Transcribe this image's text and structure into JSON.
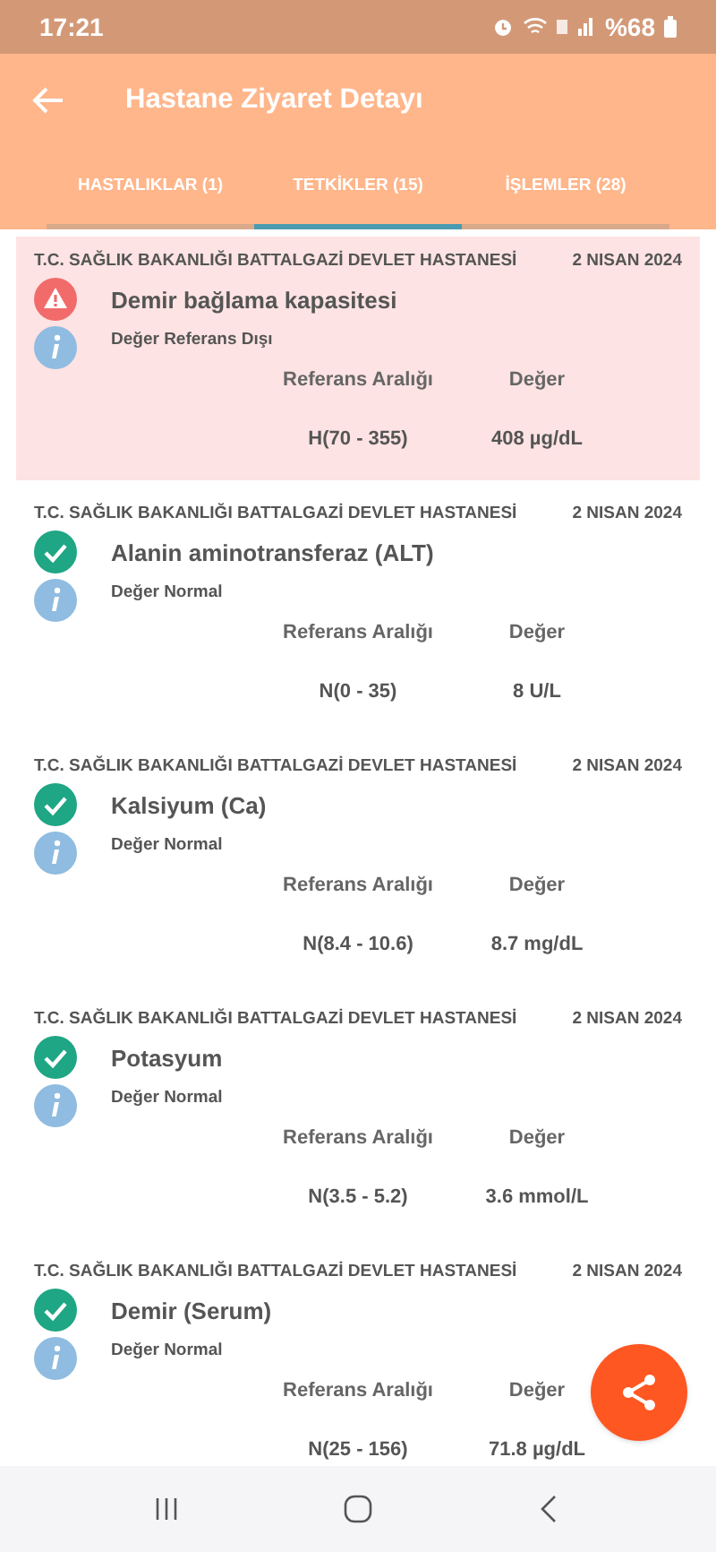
{
  "status_bar": {
    "time": "17:21",
    "battery": "%68"
  },
  "header": {
    "title": "Hastane Ziyaret Detayı"
  },
  "tabs": [
    {
      "label": "HASTALIKLAR (1)",
      "selected": false
    },
    {
      "label": "TETKİKLER (15)",
      "selected": true
    },
    {
      "label": "İŞLEMLER (28)",
      "selected": false
    }
  ],
  "tests": [
    {
      "kind": "alert",
      "hospital": "T.C. SAĞLIK BAKANLIĞI BATTALGAZİ DEVLET HASTANESİ",
      "date": "2 NISAN 2024",
      "name": "Demir bağlama kapasitesi",
      "note": "Değer Referans Dışı",
      "range_label": "Referans Aralığı",
      "value_label": "Değer",
      "range": "H(70 - 355)",
      "value": "408 µg/dL"
    },
    {
      "kind": "ok",
      "hospital": "T.C. SAĞLIK BAKANLIĞI BATTALGAZİ DEVLET HASTANESİ",
      "date": "2 NISAN 2024",
      "name": "Alanin aminotransferaz (ALT)",
      "note": "Değer Normal",
      "range_label": "Referans Aralığı",
      "value_label": "Değer",
      "range": "N(0 - 35)",
      "value": "8 U/L"
    },
    {
      "kind": "ok",
      "hospital": "T.C. SAĞLIK BAKANLIĞI BATTALGAZİ DEVLET HASTANESİ",
      "date": "2 NISAN 2024",
      "name": "Kalsiyum (Ca)",
      "note": "Değer Normal",
      "range_label": "Referans Aralığı",
      "value_label": "Değer",
      "range": "N(8.4 - 10.6)",
      "value": "8.7 mg/dL"
    },
    {
      "kind": "ok",
      "hospital": "T.C. SAĞLIK BAKANLIĞI BATTALGAZİ DEVLET HASTANESİ",
      "date": "2 NISAN 2024",
      "name": "Potasyum",
      "note": "Değer Normal",
      "range_label": "Referans Aralığı",
      "value_label": "Değer",
      "range": "N(3.5 - 5.2)",
      "value": "3.6 mmol/L"
    },
    {
      "kind": "ok",
      "hospital": "T.C. SAĞLIK BAKANLIĞI BATTALGAZİ DEVLET HASTANESİ",
      "date": "2 NISAN 2024",
      "name": "Demir (Serum)",
      "note": "Değer Normal",
      "range_label": "Referans Aralığı",
      "value_label": "Değer",
      "range": "N(25 - 156)",
      "value": "71.8 µg/dL"
    }
  ]
}
